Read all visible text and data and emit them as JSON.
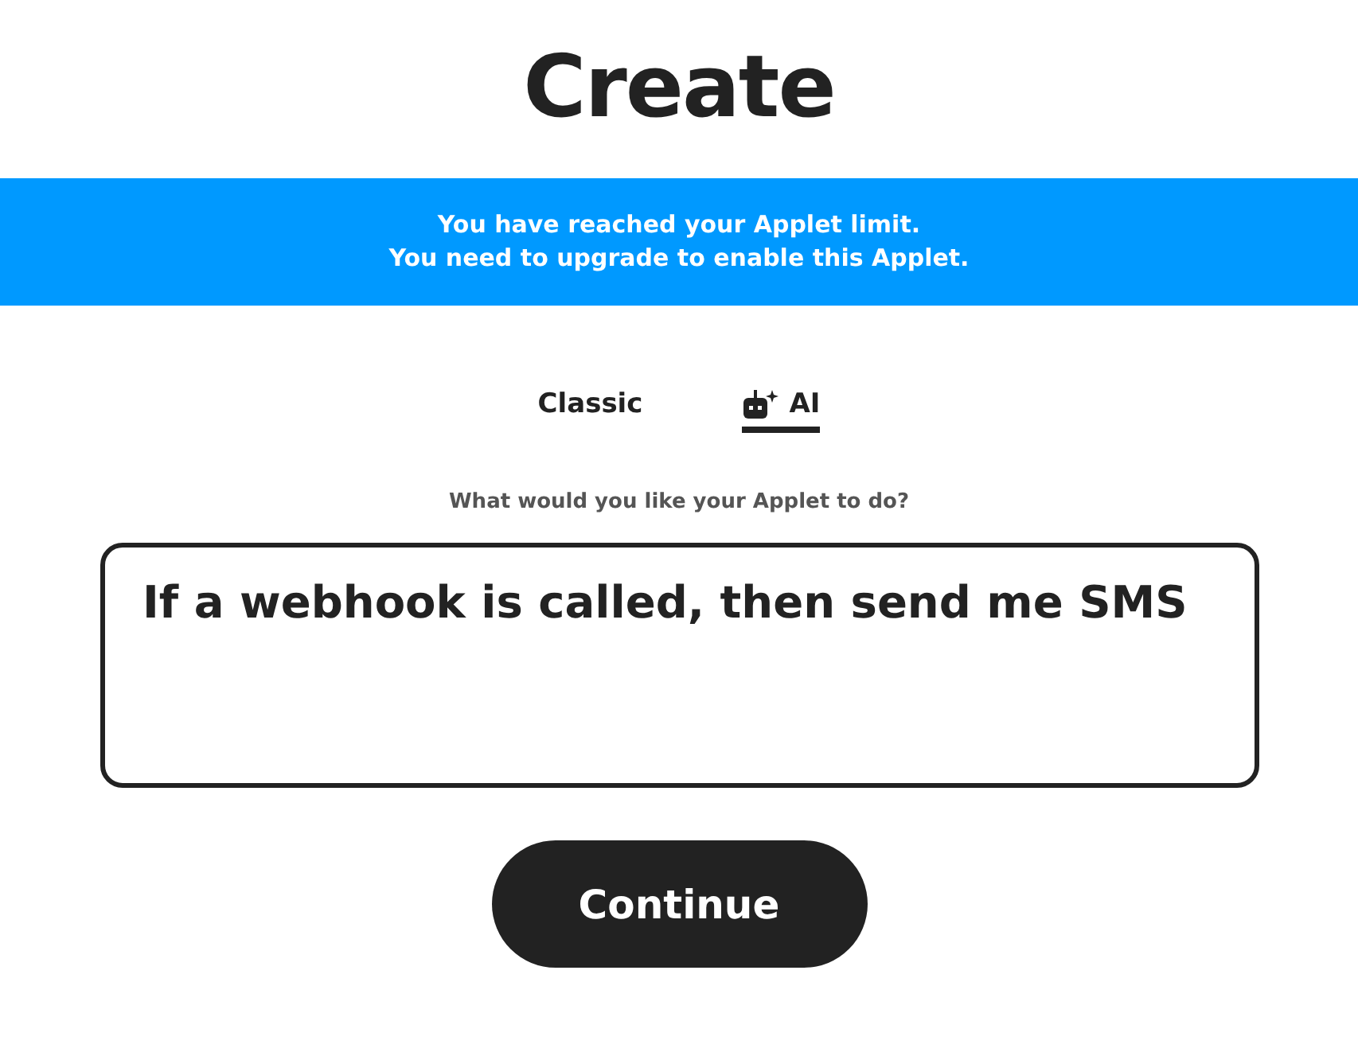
{
  "title": "Create",
  "banner": {
    "lines": [
      "You have reached your Applet limit.",
      "You need to upgrade to enable this Applet."
    ]
  },
  "tabs": [
    {
      "label": "Classic",
      "selected": false,
      "kind": "plain"
    },
    {
      "label": "AI",
      "selected": true,
      "kind": "robot"
    }
  ],
  "prompt": {
    "label": "What would you like your Applet to do?",
    "value": "If a webhook is called, then send me SMS"
  },
  "buttons": [
    "Continue"
  ]
}
